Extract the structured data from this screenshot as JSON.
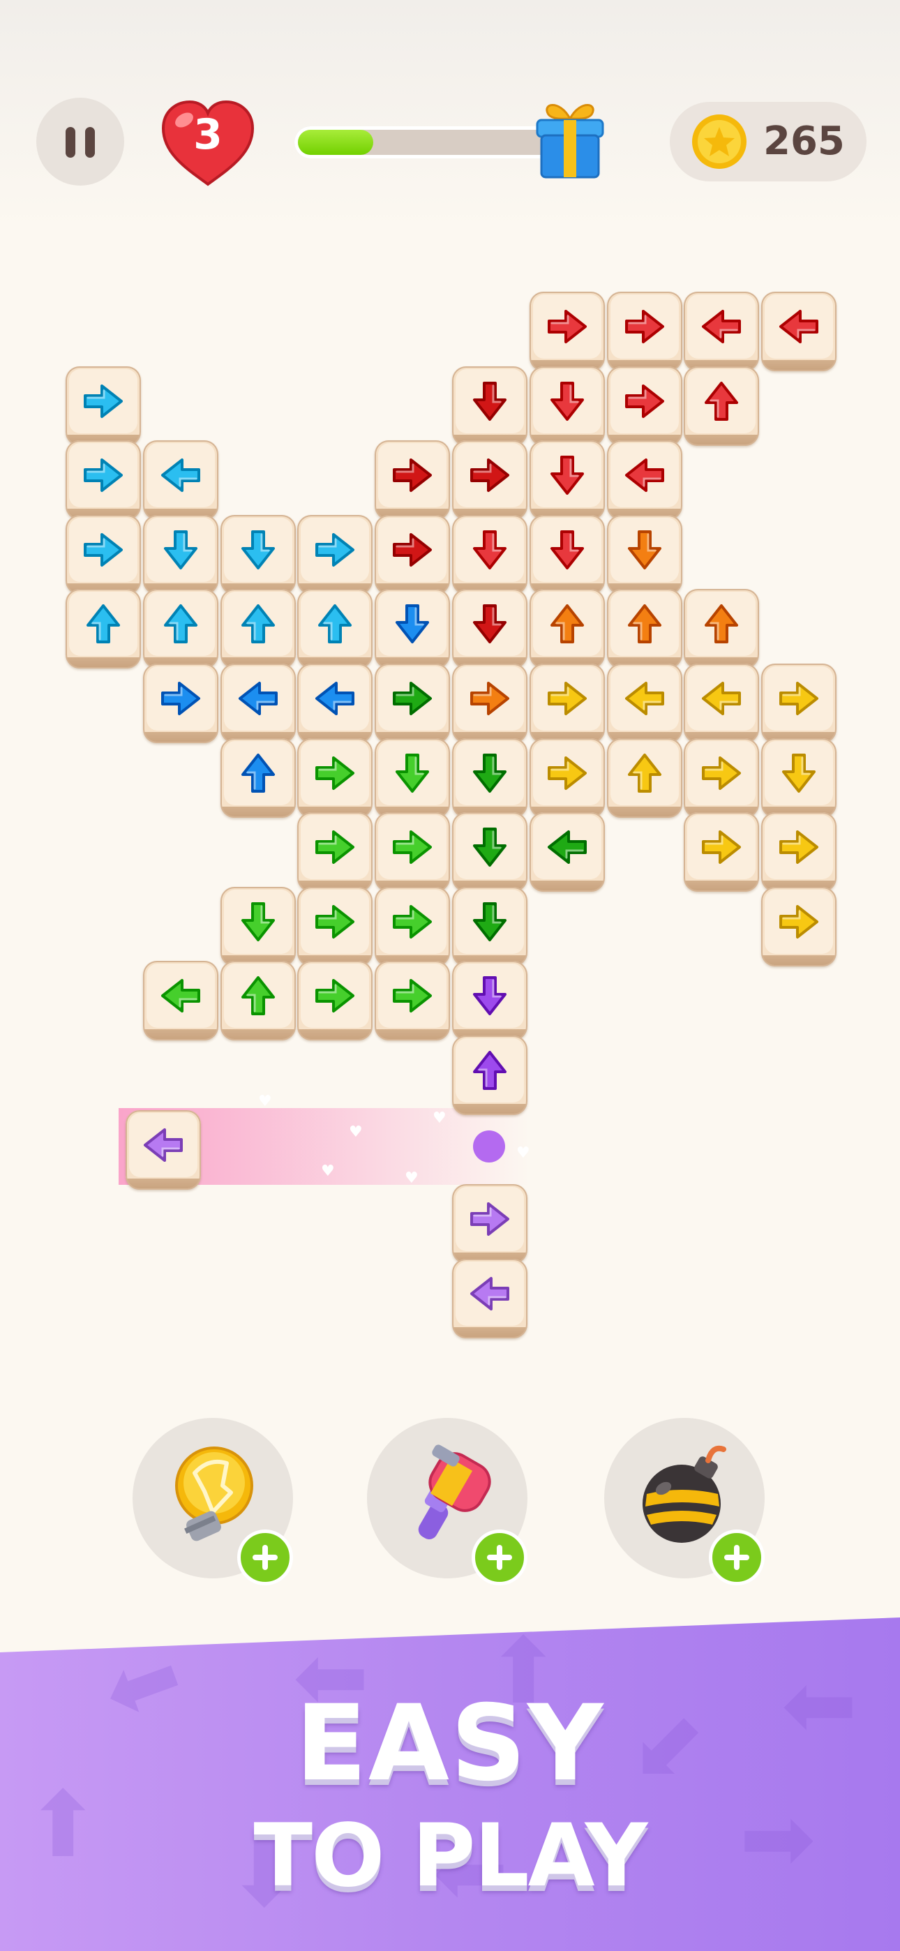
{
  "hud": {
    "lives": "3",
    "coins": "265",
    "level_progress": 0.27,
    "icons": {
      "pause": "pause-icon",
      "lives": "heart-icon",
      "reward": "gift-icon",
      "currency": "coin-icon"
    }
  },
  "colors": {
    "red": "#e8383d",
    "dark_red": "#d11616",
    "orange": "#f37f12",
    "yellow": "#f7c813",
    "green": "#46cf2c",
    "dark_green": "#1faa14",
    "cyan": "#2bbef0",
    "blue": "#1c8ef0",
    "purple": "#9d4aed",
    "lilac": "#b77af2"
  },
  "board": {
    "tiles": [
      {
        "col": 6,
        "row": 0,
        "dir": "right",
        "color": "red"
      },
      {
        "col": 7,
        "row": 0,
        "dir": "right",
        "color": "red"
      },
      {
        "col": 8,
        "row": 0,
        "dir": "left",
        "color": "red"
      },
      {
        "col": 9,
        "row": 0,
        "dir": "left",
        "color": "red"
      },
      {
        "col": 0,
        "row": 1,
        "dir": "right",
        "color": "cyan"
      },
      {
        "col": 5,
        "row": 1,
        "dir": "down",
        "color": "dark_red"
      },
      {
        "col": 6,
        "row": 1,
        "dir": "down",
        "color": "red"
      },
      {
        "col": 7,
        "row": 1,
        "dir": "right",
        "color": "red"
      },
      {
        "col": 8,
        "row": 1,
        "dir": "up",
        "color": "red"
      },
      {
        "col": 0,
        "row": 2,
        "dir": "right",
        "color": "cyan"
      },
      {
        "col": 1,
        "row": 2,
        "dir": "left",
        "color": "cyan"
      },
      {
        "col": 4,
        "row": 2,
        "dir": "right",
        "color": "dark_red"
      },
      {
        "col": 5,
        "row": 2,
        "dir": "right",
        "color": "dark_red"
      },
      {
        "col": 6,
        "row": 2,
        "dir": "down",
        "color": "red"
      },
      {
        "col": 7,
        "row": 2,
        "dir": "left",
        "color": "red"
      },
      {
        "col": 0,
        "row": 3,
        "dir": "right",
        "color": "cyan"
      },
      {
        "col": 1,
        "row": 3,
        "dir": "down",
        "color": "cyan"
      },
      {
        "col": 2,
        "row": 3,
        "dir": "down",
        "color": "cyan"
      },
      {
        "col": 3,
        "row": 3,
        "dir": "right",
        "color": "cyan"
      },
      {
        "col": 4,
        "row": 3,
        "dir": "right",
        "color": "dark_red"
      },
      {
        "col": 5,
        "row": 3,
        "dir": "down",
        "color": "red"
      },
      {
        "col": 6,
        "row": 3,
        "dir": "down",
        "color": "red"
      },
      {
        "col": 7,
        "row": 3,
        "dir": "down",
        "color": "orange"
      },
      {
        "col": 0,
        "row": 4,
        "dir": "up",
        "color": "cyan"
      },
      {
        "col": 1,
        "row": 4,
        "dir": "up",
        "color": "cyan"
      },
      {
        "col": 2,
        "row": 4,
        "dir": "up",
        "color": "cyan"
      },
      {
        "col": 3,
        "row": 4,
        "dir": "up",
        "color": "cyan"
      },
      {
        "col": 4,
        "row": 4,
        "dir": "down",
        "color": "blue"
      },
      {
        "col": 5,
        "row": 4,
        "dir": "down",
        "color": "dark_red"
      },
      {
        "col": 6,
        "row": 4,
        "dir": "up",
        "color": "orange"
      },
      {
        "col": 7,
        "row": 4,
        "dir": "up",
        "color": "orange"
      },
      {
        "col": 8,
        "row": 4,
        "dir": "up",
        "color": "orange"
      },
      {
        "col": 1,
        "row": 5,
        "dir": "right",
        "color": "blue"
      },
      {
        "col": 2,
        "row": 5,
        "dir": "left",
        "color": "blue"
      },
      {
        "col": 3,
        "row": 5,
        "dir": "left",
        "color": "blue"
      },
      {
        "col": 4,
        "row": 5,
        "dir": "right",
        "color": "dark_green"
      },
      {
        "col": 5,
        "row": 5,
        "dir": "right",
        "color": "orange"
      },
      {
        "col": 6,
        "row": 5,
        "dir": "right",
        "color": "yellow"
      },
      {
        "col": 7,
        "row": 5,
        "dir": "left",
        "color": "yellow"
      },
      {
        "col": 8,
        "row": 5,
        "dir": "left",
        "color": "yellow"
      },
      {
        "col": 9,
        "row": 5,
        "dir": "right",
        "color": "yellow"
      },
      {
        "col": 2,
        "row": 6,
        "dir": "up",
        "color": "blue"
      },
      {
        "col": 3,
        "row": 6,
        "dir": "right",
        "color": "green"
      },
      {
        "col": 4,
        "row": 6,
        "dir": "down",
        "color": "green"
      },
      {
        "col": 5,
        "row": 6,
        "dir": "down",
        "color": "dark_green"
      },
      {
        "col": 6,
        "row": 6,
        "dir": "right",
        "color": "yellow"
      },
      {
        "col": 7,
        "row": 6,
        "dir": "up",
        "color": "yellow"
      },
      {
        "col": 8,
        "row": 6,
        "dir": "right",
        "color": "yellow"
      },
      {
        "col": 9,
        "row": 6,
        "dir": "down",
        "color": "yellow"
      },
      {
        "col": 3,
        "row": 7,
        "dir": "right",
        "color": "green"
      },
      {
        "col": 4,
        "row": 7,
        "dir": "right",
        "color": "green"
      },
      {
        "col": 5,
        "row": 7,
        "dir": "down",
        "color": "dark_green"
      },
      {
        "col": 6,
        "row": 7,
        "dir": "left",
        "color": "dark_green"
      },
      {
        "col": 8,
        "row": 7,
        "dir": "right",
        "color": "yellow"
      },
      {
        "col": 9,
        "row": 7,
        "dir": "right",
        "color": "yellow"
      },
      {
        "col": 2,
        "row": 8,
        "dir": "down",
        "color": "green"
      },
      {
        "col": 3,
        "row": 8,
        "dir": "right",
        "color": "green"
      },
      {
        "col": 4,
        "row": 8,
        "dir": "right",
        "color": "green"
      },
      {
        "col": 5,
        "row": 8,
        "dir": "down",
        "color": "dark_green"
      },
      {
        "col": 9,
        "row": 8,
        "dir": "right",
        "color": "yellow"
      },
      {
        "col": 1,
        "row": 9,
        "dir": "left",
        "color": "green"
      },
      {
        "col": 2,
        "row": 9,
        "dir": "up",
        "color": "green"
      },
      {
        "col": 3,
        "row": 9,
        "dir": "right",
        "color": "green"
      },
      {
        "col": 4,
        "row": 9,
        "dir": "right",
        "color": "green"
      },
      {
        "col": 5,
        "row": 9,
        "dir": "down",
        "color": "purple"
      },
      {
        "col": 5,
        "row": 10,
        "dir": "up",
        "color": "purple"
      },
      {
        "col": 1,
        "row": 11,
        "dir": "left",
        "color": "lilac",
        "moving": true
      },
      {
        "col": 5,
        "row": 12,
        "dir": "right",
        "color": "lilac"
      },
      {
        "col": 5,
        "row": 13,
        "dir": "left",
        "color": "lilac"
      }
    ]
  },
  "boosters": [
    {
      "name": "hint-bulb-icon",
      "add": "plus-icon"
    },
    {
      "name": "hammer-icon",
      "add": "plus-icon"
    },
    {
      "name": "bomb-icon",
      "add": "plus-icon"
    }
  ],
  "promo": {
    "line1": "EASY",
    "line2": "TO PLAY"
  }
}
